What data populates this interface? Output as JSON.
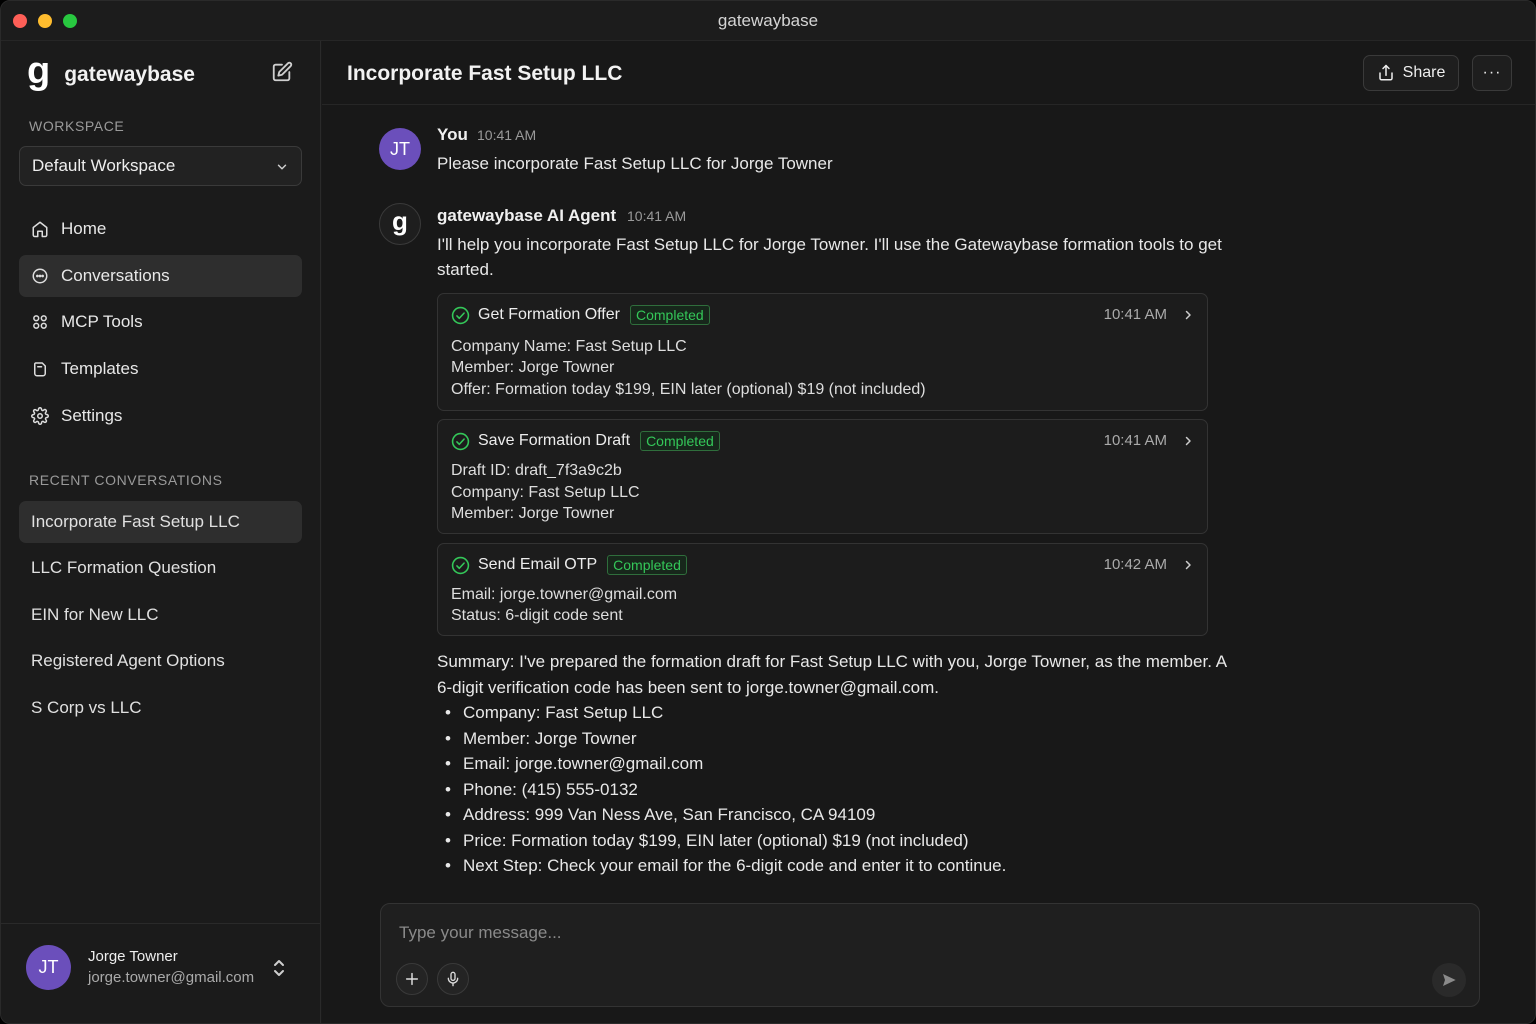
{
  "window": {
    "title": "gatewaybase"
  },
  "sidebar": {
    "brand": "gatewaybase",
    "workspace_label": "WORKSPACE",
    "workspace_value": "Default Workspace",
    "nav": [
      {
        "label": "Home",
        "icon": "home-icon"
      },
      {
        "label": "Conversations",
        "icon": "chat-icon",
        "active": true
      },
      {
        "label": "MCP Tools",
        "icon": "grid-icon"
      },
      {
        "label": "Templates",
        "icon": "template-icon"
      },
      {
        "label": "Settings",
        "icon": "gear-icon"
      }
    ],
    "recent_label": "RECENT CONVERSATIONS",
    "recent": [
      {
        "label": "Incorporate Fast Setup LLC",
        "active": true
      },
      {
        "label": "LLC Formation Question"
      },
      {
        "label": "EIN for New LLC"
      },
      {
        "label": "Registered Agent Options"
      },
      {
        "label": "S Corp vs LLC"
      }
    ],
    "user": {
      "initials": "JT",
      "name": "Jorge Towner",
      "email": "jorge.towner@gmail.com"
    }
  },
  "header": {
    "title": "Incorporate Fast Setup LLC",
    "share_label": "Share",
    "more_label": "···"
  },
  "messages": {
    "user": {
      "initials": "JT",
      "author": "You",
      "time": "10:41 AM",
      "text": "Please incorporate Fast Setup LLC for Jorge Towner"
    },
    "agent": {
      "logo": "g",
      "author": "gatewaybase AI Agent",
      "time": "10:41 AM",
      "text": "I'll help you incorporate Fast Setup LLC for Jorge Towner. I'll use the Gatewaybase formation tools to get started."
    }
  },
  "tools": [
    {
      "name": "Get Formation Offer",
      "status": "Completed",
      "time": "10:41 AM",
      "lines": [
        "Company Name: Fast Setup LLC",
        "Member: Jorge Towner",
        "Offer: Formation today $199, EIN later (optional) $19 (not included)"
      ]
    },
    {
      "name": "Save Formation Draft",
      "status": "Completed",
      "time": "10:41 AM",
      "lines": [
        "Draft ID: draft_7f3a9c2b",
        "Company: Fast Setup LLC",
        "Member: Jorge Towner"
      ]
    },
    {
      "name": "Send Email OTP",
      "status": "Completed",
      "time": "10:42 AM",
      "lines": [
        "Email: jorge.towner@gmail.com",
        "Status: 6-digit code sent"
      ]
    }
  ],
  "summary": {
    "intro": "Summary: I've prepared the formation draft for Fast Setup LLC with you, Jorge Towner, as the member. A 6-digit verification code has been sent to jorge.towner@gmail.com.",
    "bullets": [
      "Company: Fast Setup LLC",
      "Member: Jorge Towner",
      "Email: jorge.towner@gmail.com",
      "Phone: (415) 555-0132",
      "Address: 999 Van Ness Ave, San Francisco, CA 94109",
      "Price: Formation today $199, EIN later (optional) $19 (not included)",
      "Next Step: Check your email for the 6-digit code and enter it to continue."
    ]
  },
  "composer": {
    "placeholder": "Type your message..."
  },
  "colors": {
    "accent": "#6b4fbb",
    "success": "#34c759",
    "background": "#181818"
  }
}
